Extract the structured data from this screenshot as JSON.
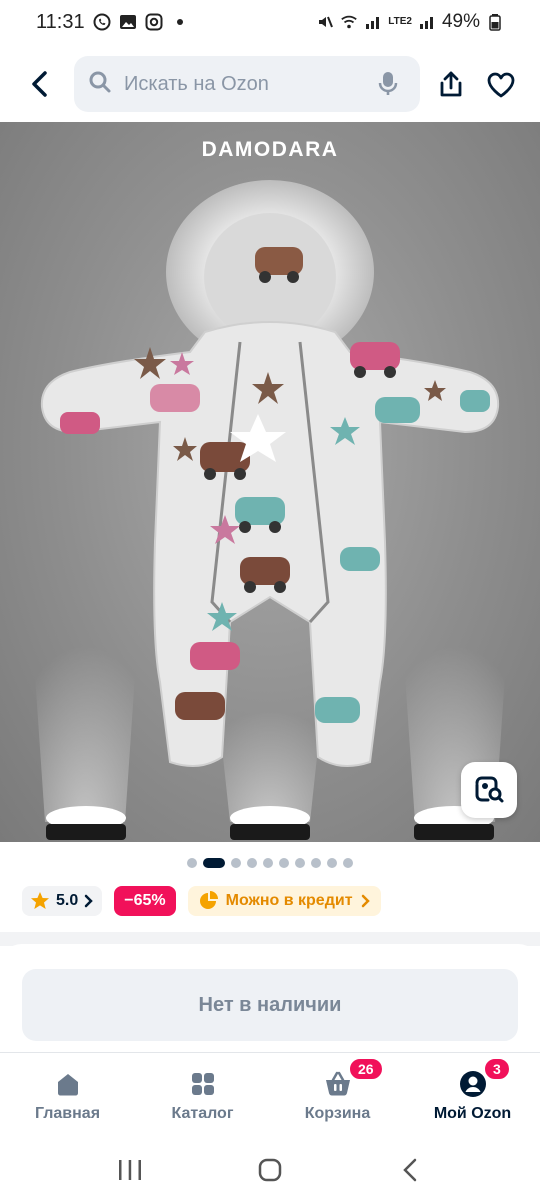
{
  "status_bar": {
    "time": "11:31",
    "battery": "49%",
    "network": "LTE2"
  },
  "header": {
    "search_placeholder": "Искать на Ozon"
  },
  "product": {
    "brand": "DAMODARA",
    "image_count": 10,
    "active_image_index": 1,
    "rating": "5.0",
    "discount": "−65%",
    "credit_label": "Можно в кредит",
    "availability": "Нет в наличии"
  },
  "bottom_nav": {
    "items": [
      {
        "label": "Главная",
        "icon": "home-icon",
        "badge": ""
      },
      {
        "label": "Каталог",
        "icon": "catalog-icon",
        "badge": ""
      },
      {
        "label": "Корзина",
        "icon": "cart-icon",
        "badge": "26"
      },
      {
        "label": "Мой Ozon",
        "icon": "profile-icon",
        "badge": "3"
      }
    ],
    "active_index": 3
  },
  "colors": {
    "accent": "#005bff",
    "discount": "#f1115a",
    "credit": "#e48a00",
    "text": "#001a34"
  }
}
